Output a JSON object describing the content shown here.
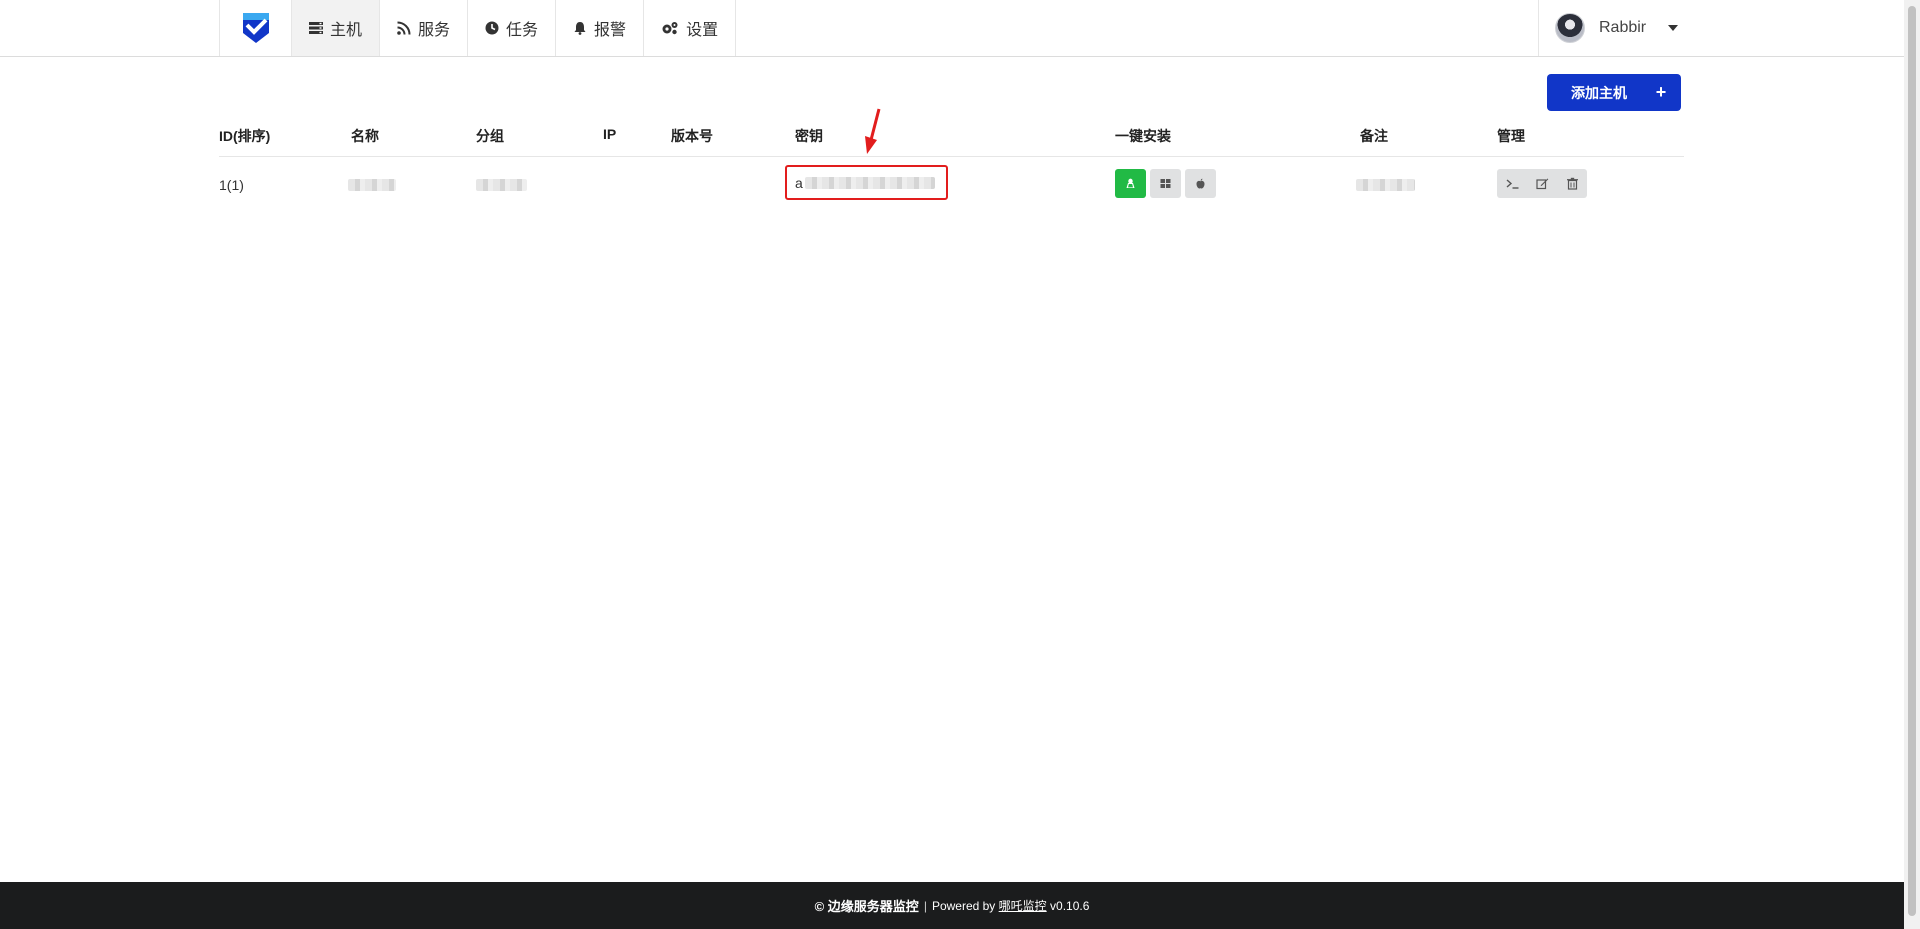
{
  "nav": {
    "logo_icon": "shield-check-logo",
    "items": [
      {
        "label": "主机",
        "icon": "server-icon",
        "active": true
      },
      {
        "label": "服务",
        "icon": "rss-icon",
        "active": false
      },
      {
        "label": "任务",
        "icon": "clock-icon",
        "active": false
      },
      {
        "label": "报警",
        "icon": "bell-icon",
        "active": false
      },
      {
        "label": "设置",
        "icon": "gears-icon",
        "active": false
      }
    ]
  },
  "user": {
    "name": "Rabbir"
  },
  "toolbar": {
    "add_host_label": "添加主机",
    "add_icon": "+"
  },
  "table": {
    "columns": [
      "ID(排序)",
      "名称",
      "分组",
      "IP",
      "版本号",
      "密钥",
      "一键安装",
      "备注",
      "管理"
    ],
    "rows": [
      {
        "id": "1(1)",
        "secret_prefix": "a"
      }
    ]
  },
  "footer": {
    "brand": "© 边缘服务器监控",
    "separator": "|",
    "powered_by": "Powered by",
    "link": "哪吒监控",
    "version": "v0.10.6"
  },
  "colors": {
    "primary": "#1136c8",
    "success": "#21ba45",
    "highlight": "#e21d1d",
    "footer_bg": "#1b1c1d"
  }
}
